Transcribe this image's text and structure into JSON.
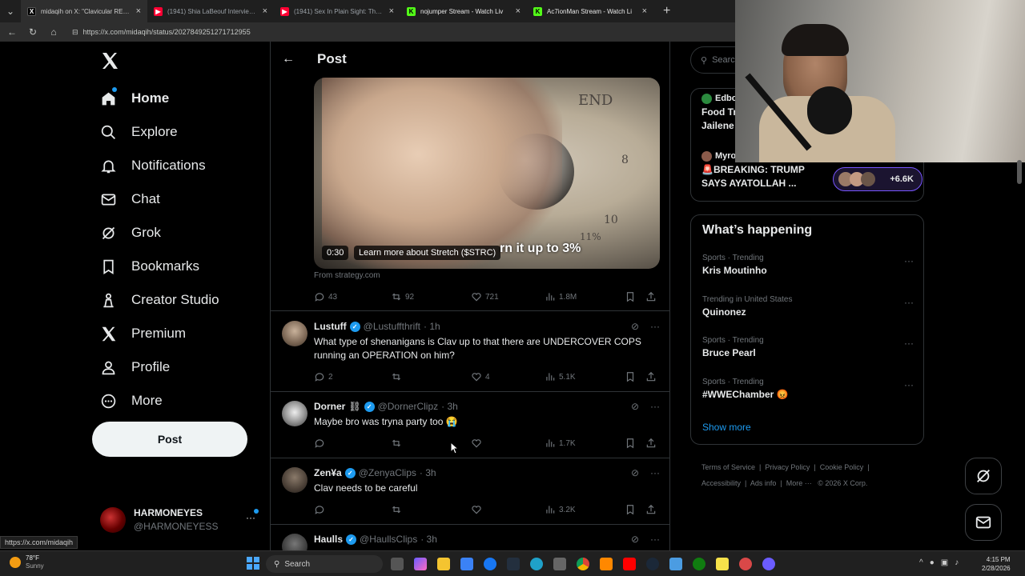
{
  "browser": {
    "tabs": [
      {
        "label": "midaqih on X: \"Clavicular REALIZE",
        "icon": "x-icon",
        "color": "#000000"
      },
      {
        "label": "(1941) Shia LaBeouf Interview - Yo",
        "icon": "youtube-icon",
        "color": "#ff0033"
      },
      {
        "label": "(1941) Sex In Plain Sight: The Figu",
        "icon": "youtube-icon",
        "color": "#ff0033"
      },
      {
        "label": "nojumper Stream - Watch Liv",
        "icon": "kick-icon",
        "color": "#53fc18"
      },
      {
        "label": "Ac7ionMan Stream - Watch Li",
        "icon": "kick-icon",
        "color": "#53fc18"
      }
    ],
    "new_tab": "+",
    "url": "https://x.com/midaqih/status/2027849251271712955",
    "status_url": "https://x.com/midaqih"
  },
  "sidenav": {
    "logo": "X",
    "items": [
      {
        "label": "Home",
        "icon": "home-icon"
      },
      {
        "label": "Explore",
        "icon": "search-icon"
      },
      {
        "label": "Notifications",
        "icon": "bell-icon"
      },
      {
        "label": "Chat",
        "icon": "mail-icon"
      },
      {
        "label": "Grok",
        "icon": "grok-icon"
      },
      {
        "label": "Bookmarks",
        "icon": "bookmark-icon"
      },
      {
        "label": "Creator Studio",
        "icon": "creator-studio-icon"
      },
      {
        "label": "Premium",
        "icon": "x-premium-icon"
      },
      {
        "label": "Profile",
        "icon": "person-icon"
      },
      {
        "label": "More",
        "icon": "more-circle-icon"
      }
    ],
    "post_button": "Post",
    "profile": {
      "name": "HARMONEYES",
      "handle": "@HARMONEYESS",
      "menu": "···"
    }
  },
  "main": {
    "header_title": "Post",
    "video": {
      "time": "0:30",
      "learn_more": "Learn more about Stretch ($STRC)",
      "caption": "rn it up to 3%",
      "dial_text": "END",
      "dial_numbers": [
        "8",
        "10",
        "11%"
      ]
    },
    "source": "From strategy.com",
    "stats": {
      "replies": "43",
      "reposts": "92",
      "likes": "721",
      "views": "1.8M"
    },
    "replies": [
      {
        "name": "Lustuff",
        "handle": "@Lustuffthrift",
        "time": "· 1h",
        "text": "What type of shenanigans is Clav up to that there are UNDERCOVER COPS running an OPERATION on him?",
        "replies": "2",
        "reposts": "",
        "likes": "4",
        "views": "5.1K"
      },
      {
        "name": "Dorner",
        "badge": "⛓",
        "handle": "@DornerClipz",
        "time": "· 3h",
        "text": "Maybe bro was tryna party too 😭",
        "replies": "",
        "reposts": "",
        "likes": "",
        "views": "1.7K"
      },
      {
        "name": "Zen¥a",
        "handle": "@ZenyaClips",
        "time": "· 3h",
        "text": "Clav needs to be careful",
        "replies": "",
        "reposts": "",
        "likes": "",
        "views": "3.2K"
      },
      {
        "name": "Haulls",
        "handle": "@HaullsClips",
        "time": "· 3h",
        "text": "",
        "replies": "",
        "reposts": "",
        "likes": "",
        "views": ""
      }
    ]
  },
  "right": {
    "search_placeholder": "Search",
    "top_trends": [
      {
        "user": "Edbo",
        "title": "Food Tr",
        "sub": "Jailene"
      },
      {
        "user": "Myro",
        "title": "🚨BREAKING: TRUMP SAYS AYATOLLAH ...",
        "count": "+6.6K"
      }
    ],
    "happening": {
      "title": "What’s happening",
      "trends": [
        {
          "category": "Sports · Trending",
          "name": "Kris Moutinho"
        },
        {
          "category": "Trending in United States",
          "name": "Quinonez"
        },
        {
          "category": "Sports · Trending",
          "name": "Bruce Pearl"
        },
        {
          "category": "Sports · Trending",
          "name": "#WWEChamber 😡"
        }
      ],
      "show_more": "Show more"
    },
    "footer": {
      "links": [
        "Terms of Service",
        "Privacy Policy",
        "Cookie Policy",
        "Accessibility",
        "Ads info",
        "More ···"
      ],
      "copyright": "© 2026 X Corp."
    }
  },
  "taskbar": {
    "weather_temp": "78°F",
    "weather_desc": "Sunny",
    "search": "Search",
    "time": "4:15 PM",
    "date": "2/28/2026"
  },
  "colors": {
    "accent": "#1d9bf0",
    "background": "#000000",
    "border": "#2f3336",
    "muted": "#71767b"
  }
}
